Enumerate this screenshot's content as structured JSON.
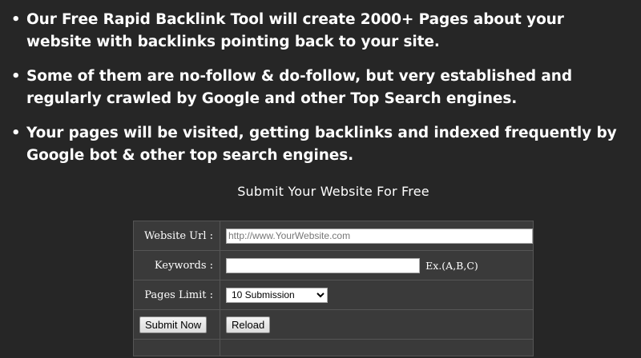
{
  "bullets": [
    {
      "text": "Our Free Rapid Backlink Tool will create 2000+  Pages about your website  with backlinks pointing back to your site."
    },
    {
      "text": "Some of them are no-follow & do-follow, but  very established and regularly crawled by Google and other Top Search engines."
    },
    {
      "text": "Your pages will be visited, getting backlinks and indexed  frequently by Google bot & other top search engines."
    }
  ],
  "bullet_glyph": "•",
  "form": {
    "heading": "Submit Your Website For Free",
    "website_url": {
      "label": "Website Url :",
      "placeholder": "http://www.YourWebsite.com",
      "value": ""
    },
    "keywords": {
      "label": "Keywords :",
      "value": "",
      "hint": "Ex.(A,B,C)"
    },
    "pages_limit": {
      "label": "Pages Limit :",
      "selected": "10 Submission"
    },
    "submit_label": "Submit Now",
    "reload_label": "Reload"
  },
  "colors": {
    "background": "#262626",
    "table_cell": "#3a3a3a",
    "table_border": "#555555",
    "text": "#ffffff"
  }
}
